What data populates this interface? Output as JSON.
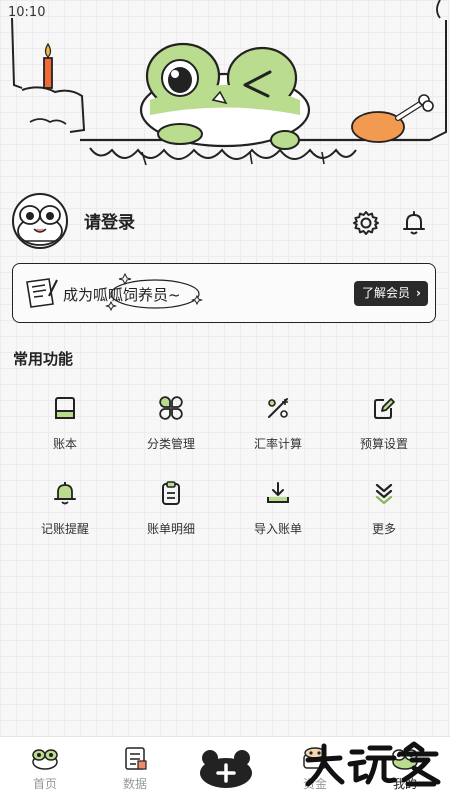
{
  "status_bar": {
    "time": "10:10"
  },
  "profile": {
    "login_text": "请登录"
  },
  "banner": {
    "text": "成为呱呱饲养员~",
    "button_label": "了解会员",
    "button_chevron": "›"
  },
  "section": {
    "title": "常用功能"
  },
  "features": [
    {
      "label": "账本",
      "icon": "book-icon"
    },
    {
      "label": "分类管理",
      "icon": "clover-icon"
    },
    {
      "label": "汇率计算",
      "icon": "exchange-rate-icon"
    },
    {
      "label": "预算设置",
      "icon": "edit-icon"
    },
    {
      "label": "记账提醒",
      "icon": "bell-icon"
    },
    {
      "label": "账单明细",
      "icon": "clipboard-icon"
    },
    {
      "label": "导入账单",
      "icon": "import-icon"
    },
    {
      "label": "更多",
      "icon": "chevron-down-double-icon"
    }
  ],
  "nav": {
    "items": [
      {
        "label": "首页",
        "icon": "frog-home-icon"
      },
      {
        "label": "数据",
        "icon": "data-book-icon"
      },
      {
        "label": "资金",
        "icon": "wallet-frog-icon"
      },
      {
        "label": "我的",
        "icon": "frog-me-icon"
      }
    ],
    "add_symbol": "+"
  },
  "colors": {
    "accent_green": "#b9dc8e",
    "dark": "#2a2a2a",
    "candle": "#ef6a34",
    "drumstick": "#f29a4f"
  }
}
